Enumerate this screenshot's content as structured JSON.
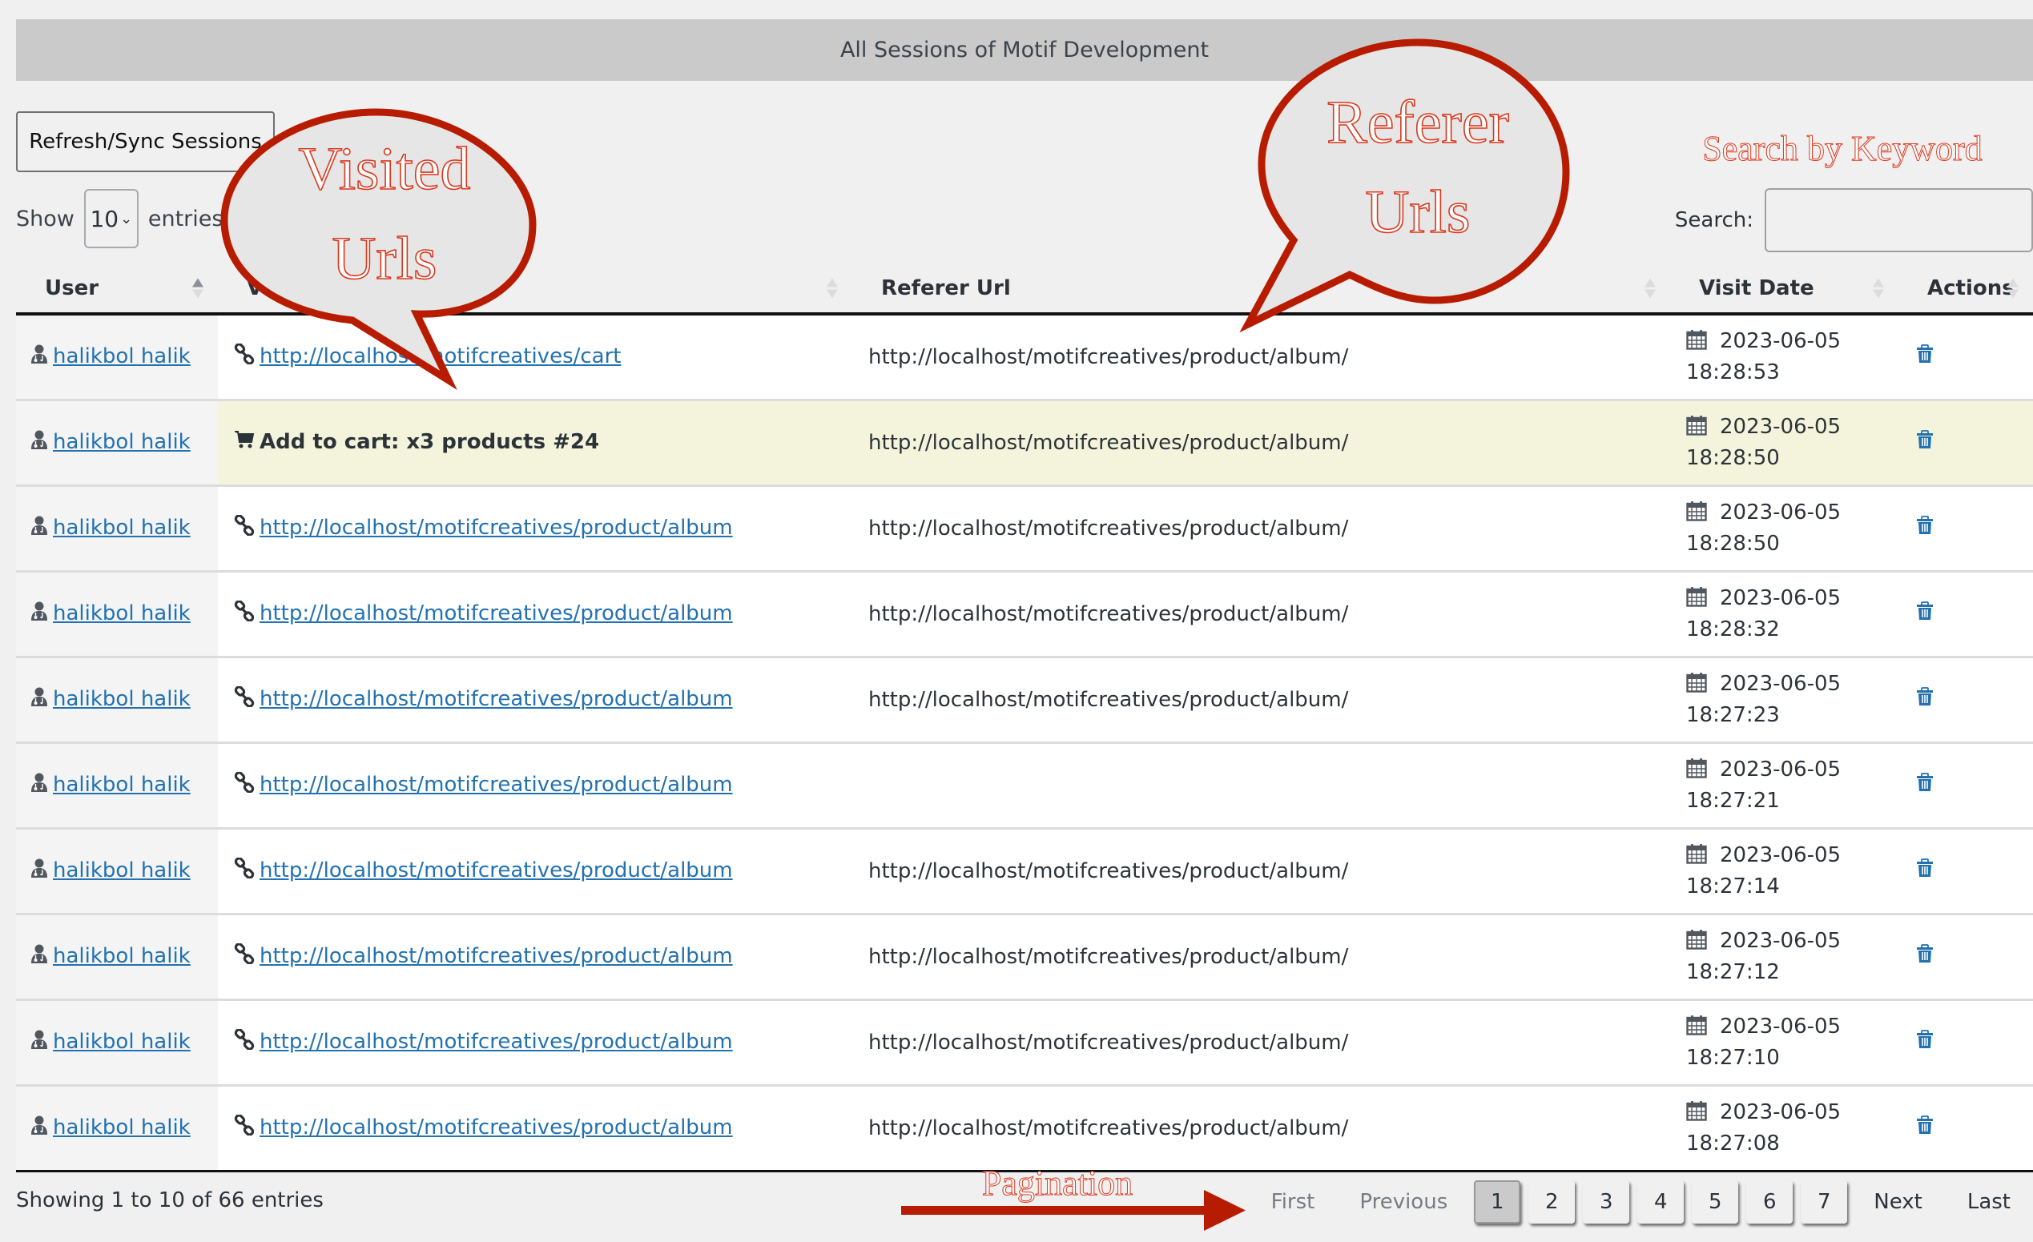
{
  "title_bar": "All Sessions of Motif Development",
  "toolbar": {
    "refresh_label": "Refresh/Sync Sessions",
    "show_label": "Show",
    "entries_label": "entries",
    "page_length": "10",
    "search_label": "Search:",
    "search_value": ""
  },
  "table": {
    "columns": [
      {
        "label": "User",
        "sort": "ascending"
      },
      {
        "label": "Visited Url",
        "sort": "none"
      },
      {
        "label": "Referer Url",
        "sort": "none"
      },
      {
        "label": "Visit Date",
        "sort": "none"
      },
      {
        "label": "Actions",
        "sort": "none"
      }
    ],
    "rows": [
      {
        "user": "halikbol halik",
        "visited_type": "link",
        "visited": "http://localhost/motifcreatives/cart",
        "referer": "http://localhost/motifcreatives/product/album/",
        "date": "2023-06-05",
        "time": "18:28:53"
      },
      {
        "user": "halikbol halik",
        "visited_type": "cart",
        "visited": "Add to cart: x3 products #24",
        "referer": "http://localhost/motifcreatives/product/album/",
        "date": "2023-06-05",
        "time": "18:28:50"
      },
      {
        "user": "halikbol halik",
        "visited_type": "link",
        "visited": "http://localhost/motifcreatives/product/album",
        "referer": "http://localhost/motifcreatives/product/album/",
        "date": "2023-06-05",
        "time": "18:28:50"
      },
      {
        "user": "halikbol halik",
        "visited_type": "link",
        "visited": "http://localhost/motifcreatives/product/album",
        "referer": "http://localhost/motifcreatives/product/album/",
        "date": "2023-06-05",
        "time": "18:28:32"
      },
      {
        "user": "halikbol halik",
        "visited_type": "link",
        "visited": "http://localhost/motifcreatives/product/album",
        "referer": "http://localhost/motifcreatives/product/album/",
        "date": "2023-06-05",
        "time": "18:27:23"
      },
      {
        "user": "halikbol halik",
        "visited_type": "link",
        "visited": "http://localhost/motifcreatives/product/album",
        "referer": "",
        "date": "2023-06-05",
        "time": "18:27:21"
      },
      {
        "user": "halikbol halik",
        "visited_type": "link",
        "visited": "http://localhost/motifcreatives/product/album",
        "referer": "http://localhost/motifcreatives/product/album/",
        "date": "2023-06-05",
        "time": "18:27:14"
      },
      {
        "user": "halikbol halik",
        "visited_type": "link",
        "visited": "http://localhost/motifcreatives/product/album",
        "referer": "http://localhost/motifcreatives/product/album/",
        "date": "2023-06-05",
        "time": "18:27:12"
      },
      {
        "user": "halikbol halik",
        "visited_type": "link",
        "visited": "http://localhost/motifcreatives/product/album",
        "referer": "http://localhost/motifcreatives/product/album/",
        "date": "2023-06-05",
        "time": "18:27:10"
      },
      {
        "user": "halikbol halik",
        "visited_type": "link",
        "visited": "http://localhost/motifcreatives/product/album",
        "referer": "http://localhost/motifcreatives/product/album/",
        "date": "2023-06-05",
        "time": "18:27:08"
      }
    ]
  },
  "footer": {
    "info": "Showing 1 to 10 of 66 entries",
    "pagination": {
      "first": "First",
      "previous": "Previous",
      "pages": [
        "1",
        "2",
        "3",
        "4",
        "5",
        "6",
        "7"
      ],
      "current": "1",
      "next": "Next",
      "last": "Last"
    }
  },
  "annotations": {
    "visited_line1": "Visited",
    "visited_line2": "Urls",
    "referer_line1": "Referer",
    "referer_line2": "Urls",
    "search_hint": "Search by Keyword",
    "pagination_hint": "Pagination",
    "color": "#b81c00"
  },
  "colors": {
    "link": "#2271b1",
    "highlight_row": "#f4f4dc",
    "title_bar": "#cacaca",
    "annotation_red": "#b81c00"
  }
}
